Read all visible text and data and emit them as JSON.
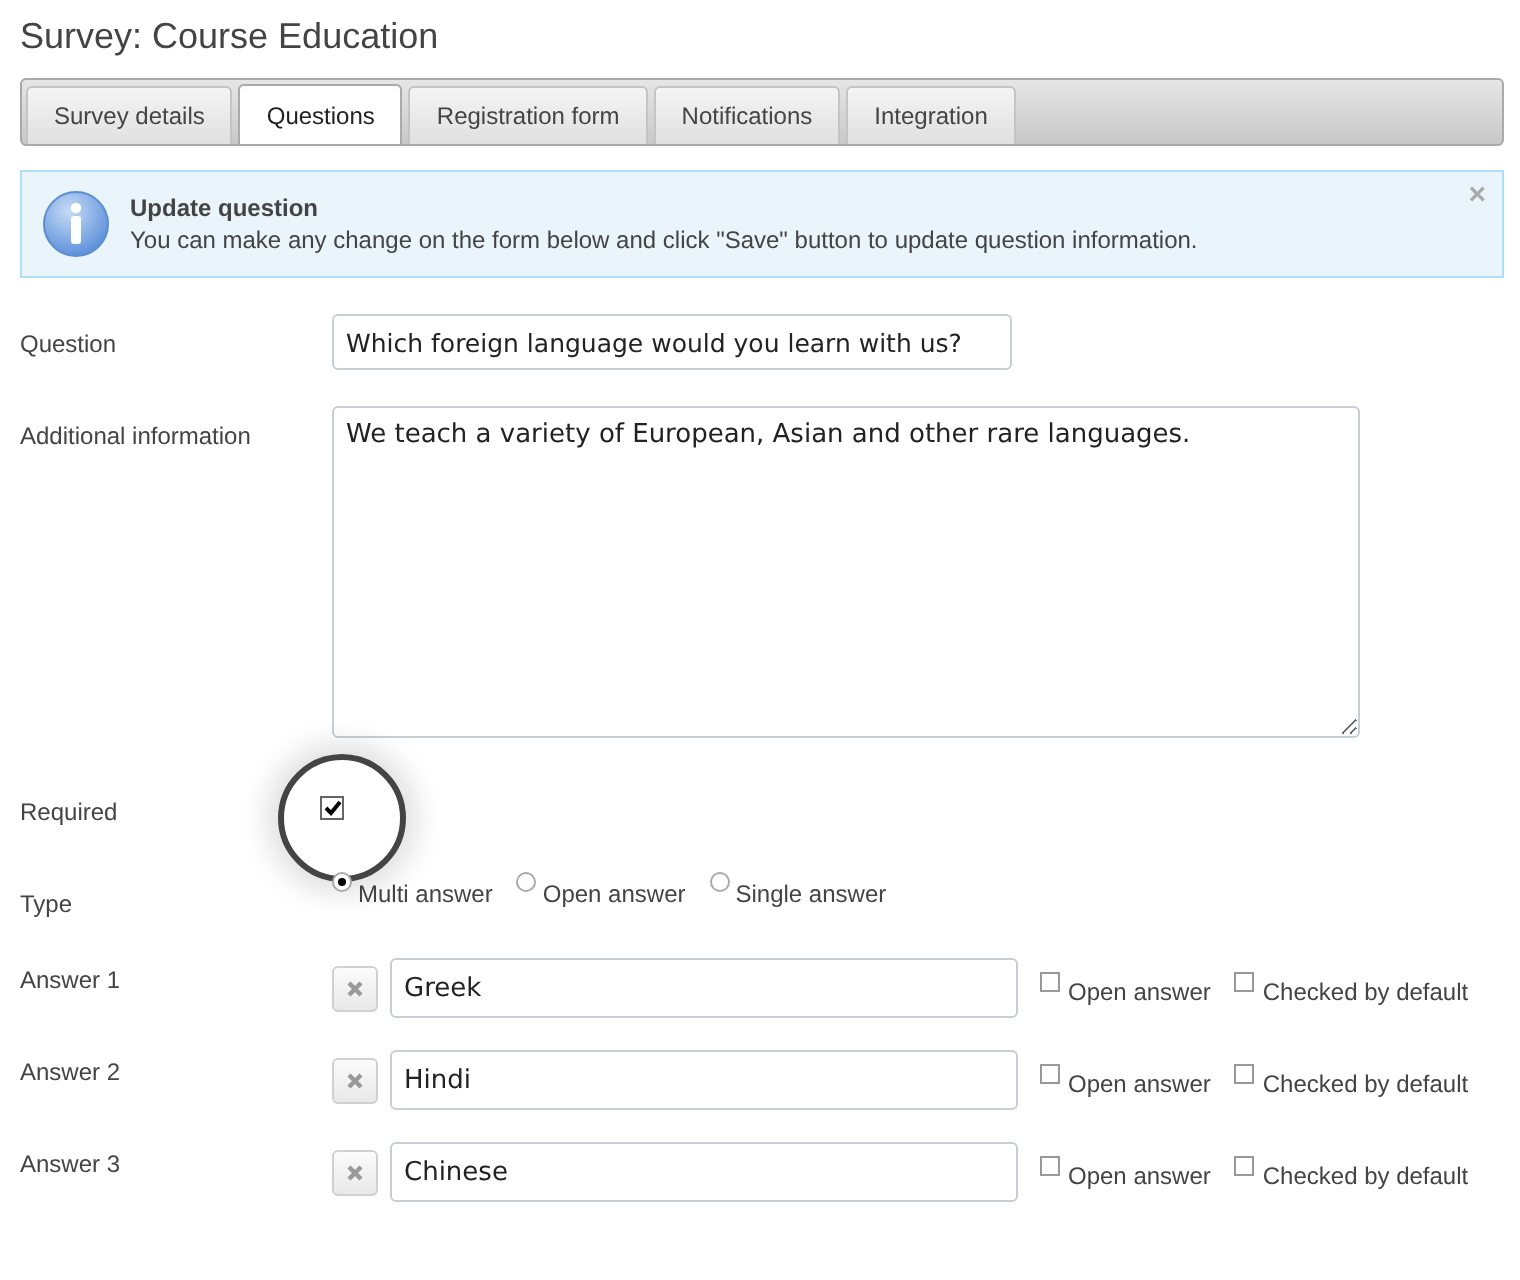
{
  "page": {
    "title": "Survey: Course Education"
  },
  "tabs": [
    {
      "label": "Survey details",
      "selected": false
    },
    {
      "label": "Questions",
      "selected": true
    },
    {
      "label": "Registration form",
      "selected": false
    },
    {
      "label": "Notifications",
      "selected": false
    },
    {
      "label": "Integration",
      "selected": false
    }
  ],
  "notice": {
    "title": "Update question",
    "message": "You can make any change on the form below and click \"Save\" button to update question information.",
    "close": "×"
  },
  "form": {
    "question": {
      "label": "Question",
      "value": "Which foreign language would you learn with us?"
    },
    "additional_info": {
      "label": "Additional information",
      "value": "We teach a variety of European, Asian and other rare languages."
    },
    "required": {
      "label": "Required",
      "checked": true,
      "highlighted": true
    },
    "type": {
      "label": "Type",
      "options": [
        {
          "label": "Multi answer",
          "selected": true
        },
        {
          "label": "Open answer",
          "selected": false
        },
        {
          "label": "Single answer",
          "selected": false
        }
      ]
    },
    "answers": [
      {
        "label": "Answer 1",
        "value": "Greek",
        "open_answer": {
          "label": "Open answer",
          "checked": false
        },
        "checked_by_default": {
          "label": "Checked by default",
          "checked": false
        }
      },
      {
        "label": "Answer 2",
        "value": "Hindi",
        "open_answer": {
          "label": "Open answer",
          "checked": false
        },
        "checked_by_default": {
          "label": "Checked by default",
          "checked": false
        }
      },
      {
        "label": "Answer 3",
        "value": "Chinese",
        "open_answer": {
          "label": "Open answer",
          "checked": false
        },
        "checked_by_default": {
          "label": "Checked by default",
          "checked": false
        }
      }
    ]
  }
}
